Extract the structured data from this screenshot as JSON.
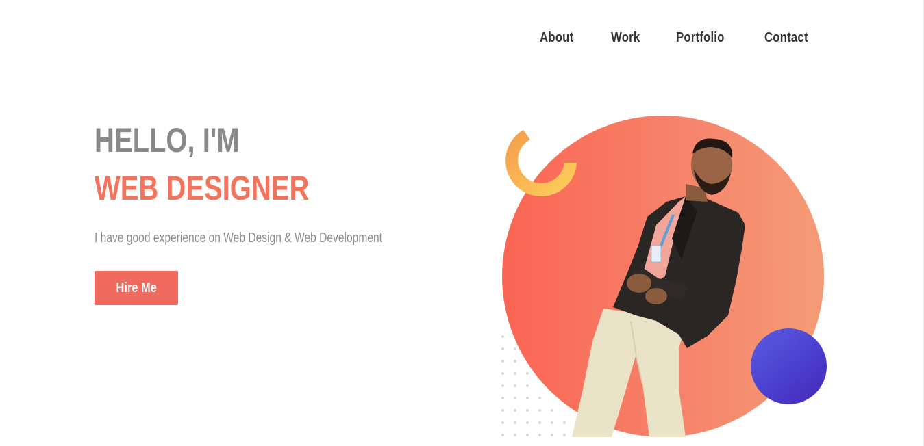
{
  "nav": {
    "items": [
      "About",
      "Work",
      "Portfolio",
      "Contact"
    ]
  },
  "hero": {
    "greeting": "HELLO, I'M",
    "role": "WEB DESIGNER",
    "subtitle": "I have good experience on Web Design & Web Development",
    "cta_label": "Hire Me"
  },
  "colors": {
    "accent": "#f3735d",
    "button": "#f06a5f",
    "greeting": "#8a8a8a",
    "nav_text": "#333333",
    "blue_ball": "#4a3fcf",
    "ring_start": "#f6a24a",
    "ring_end": "#fcd25c"
  }
}
